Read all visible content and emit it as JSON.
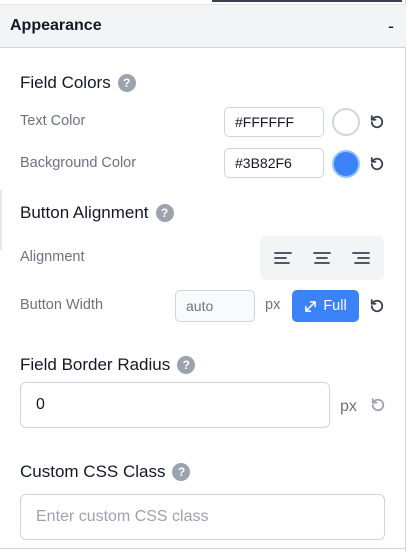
{
  "panel": {
    "title": "Appearance",
    "collapse_symbol": "-"
  },
  "field_colors": {
    "title": "Field Colors",
    "help": "?",
    "text_color": {
      "label": "Text Color",
      "value": "#FFFFFF",
      "swatch": "#FFFFFF"
    },
    "background_color": {
      "label": "Background Color",
      "value": "#3B82F6",
      "swatch": "#3B82F6"
    }
  },
  "button_alignment": {
    "title": "Button Alignment",
    "help": "?",
    "alignment": {
      "label": "Alignment",
      "options": [
        "align-left-icon",
        "align-center-icon",
        "align-right-icon"
      ]
    },
    "button_width": {
      "label": "Button Width",
      "placeholder": "auto",
      "unit": "px",
      "full_label": "Full",
      "full_icon": "expand-icon"
    }
  },
  "field_border_radius": {
    "title": "Field Border Radius",
    "help": "?",
    "value": "0",
    "unit": "px"
  },
  "custom_css": {
    "title": "Custom CSS Class",
    "help": "?",
    "placeholder": "Enter custom CSS class"
  },
  "colors": {
    "accent": "#3B82F6",
    "header_bg": "#F3F4F6",
    "muted_text": "#6B7280"
  }
}
